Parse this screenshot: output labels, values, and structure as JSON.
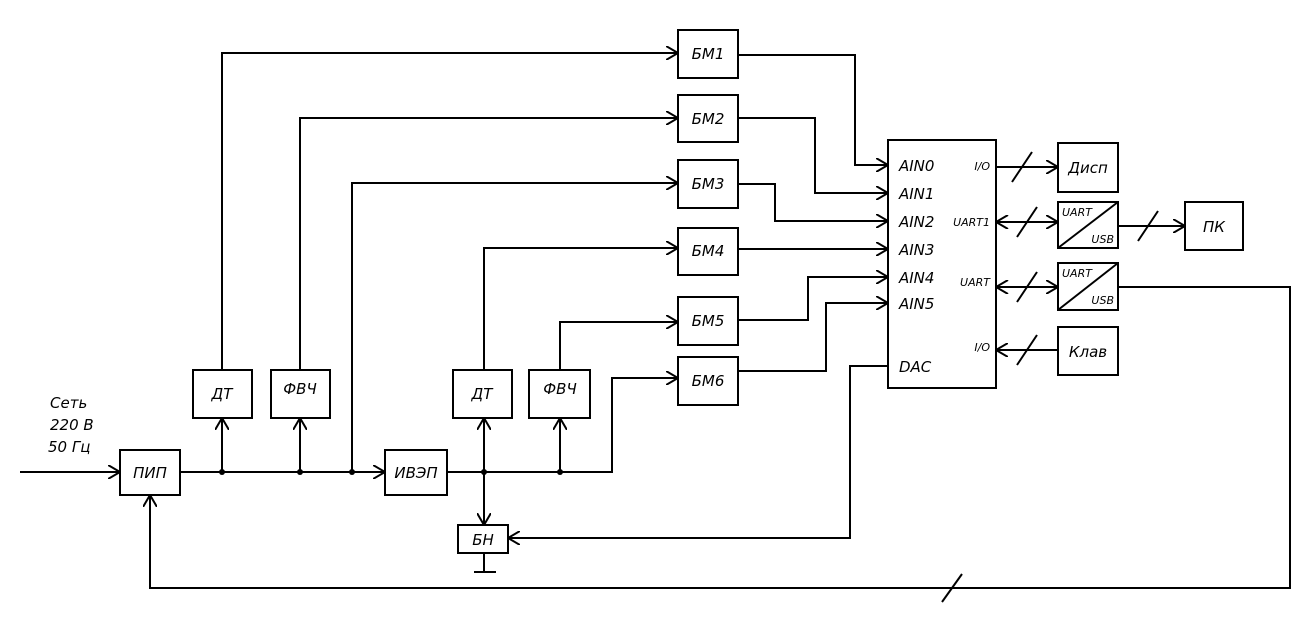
{
  "source": {
    "lines": [
      "Сеть",
      "220 В",
      "50 Гц"
    ]
  },
  "blocks": {
    "pip": "ПИП",
    "dt1": "ДТ",
    "fvch1": "ФВЧ",
    "iveп": "ИВЭП",
    "dt2": "ДТ",
    "fvch2": "ФВЧ",
    "bn": "БН",
    "bm1": "БМ1",
    "bm2": "БМ2",
    "bm3": "БМ3",
    "bm4": "БМ4",
    "bm5": "БМ5",
    "bm6": "БМ6",
    "disp": "Дисп",
    "pc": "ПК",
    "klav": "Клав",
    "conv_top": "UART",
    "conv_bottom": "USB"
  },
  "mcu": {
    "inputs": [
      "AIN0",
      "AIN1",
      "AIN2",
      "AIN3",
      "AIN4",
      "AIN5"
    ],
    "dac": "DAC",
    "io1": "I/O",
    "uart1": "UART1",
    "uart2": "UART",
    "io2": "I/O"
  }
}
